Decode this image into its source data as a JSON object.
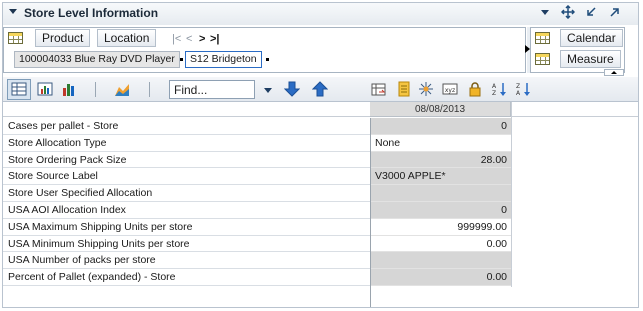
{
  "header": {
    "title": "Store Level Information"
  },
  "pivot": {
    "rows_buttons": [
      "Product",
      "Location"
    ],
    "nav": [
      "|<",
      "<",
      ">",
      ">|"
    ],
    "chips": [
      "100004033 Blue Ray DVD Player",
      "S12 Bridgeton"
    ],
    "cols_buttons": [
      "Calendar",
      "Measure"
    ]
  },
  "toolbar": {
    "find_placeholder": "Find..."
  },
  "grid": {
    "column_header": "08/08/2013",
    "rows": [
      {
        "label": "Cases per pallet - Store",
        "value": "0",
        "style": "ro",
        "align": "r"
      },
      {
        "label": "Store Allocation Type",
        "value": "None",
        "style": "ed",
        "align": "l"
      },
      {
        "label": "Store Ordering Pack Size",
        "value": "28.00",
        "style": "ro",
        "align": "r"
      },
      {
        "label": "Store Source Label",
        "value": "V3000 APPLE*",
        "style": "ro",
        "align": "l"
      },
      {
        "label": "Store User Specified Allocation",
        "value": "",
        "style": "ro",
        "align": "r"
      },
      {
        "label": "USA AOI Allocation Index",
        "value": "0",
        "style": "ro",
        "align": "r"
      },
      {
        "label": "USA Maximum Shipping Units per store",
        "value": "999999.00",
        "style": "ed",
        "align": "r"
      },
      {
        "label": "USA Minimum Shipping Units per store",
        "value": "0.00",
        "style": "ed",
        "align": "r"
      },
      {
        "label": "USA Number of packs per store",
        "value": "",
        "style": "ro",
        "align": "r"
      },
      {
        "label": "Percent of Pallet (expanded) - Store",
        "value": "0.00",
        "style": "ro",
        "align": "r"
      }
    ]
  },
  "colors": {
    "header_text": "#1c2a39",
    "readonly_cell": "#d6d6d6",
    "accent_blue": "#2b6cc4"
  }
}
